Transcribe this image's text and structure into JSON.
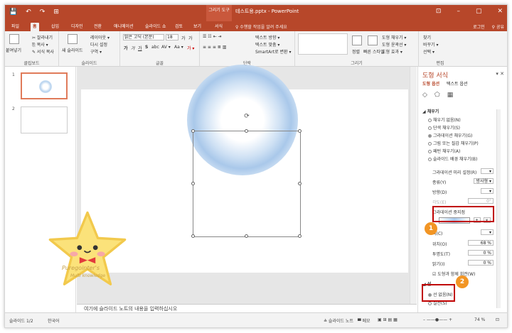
{
  "titlebar": {
    "qat": [
      "💾",
      "↶",
      "↷",
      "⊞"
    ],
    "context_tab": "그리기 도구",
    "doc_title": "테스트용.pptx - PowerPoint",
    "win": [
      "⊡",
      "–",
      "▢",
      "✕"
    ]
  },
  "tabs": [
    "파일",
    "홈",
    "삽입",
    "디자인",
    "전환",
    "애니메이션",
    "슬라이드 쇼",
    "검토",
    "보기",
    "서식"
  ],
  "tell_me": "♀ 수행할 작업을 알려 주세요",
  "login": "로그인",
  "share": "⚲ 공유",
  "ribbon": {
    "clipboard": {
      "paste": "붙여넣기",
      "cut": "✂ 잘라내기",
      "copy": "⎘ 복사 ▾",
      "format_painter": "✎ 서식 복사",
      "label": "클립보드"
    },
    "slides": {
      "new": "새 슬라이드",
      "layout": "레이아웃 ▾",
      "reset": "다시 설정",
      "section": "구역 ▾",
      "label": "슬라이드"
    },
    "font": {
      "name": "맑은 고딕 (본문)",
      "size": "18",
      "grow": "가",
      "shrink": "가",
      "clear": "가",
      "bold": "가",
      "italic": "가",
      "underline": "가",
      "strike": "S",
      "abc": "abc",
      "spacing": "AV ▾",
      "case": "Aa ▾",
      "color": "가 ▾",
      "label": "글꼴"
    },
    "paragraph": {
      "direction": "텍스트 방향 ▾",
      "align": "텍스트 맞춤 ▾",
      "smartart": "SmartArt로 변환 ▾",
      "label": "단락"
    },
    "drawing": {
      "arrange": "정렬",
      "quick": "빠른 스타일",
      "fill": "도형 채우기 ▾",
      "outline": "도형 윤곽선 ▾",
      "effect": "도형 효과 ▾",
      "label": "그리기"
    },
    "editing": {
      "find": "찾기",
      "replace": "바꾸기 ▾",
      "select": "선택 ▾",
      "label": "편집"
    }
  },
  "thumbnails": [
    {
      "num": "1"
    },
    {
      "num": "2"
    }
  ],
  "notes_placeholder": "여기에 슬라이드 노트의 내용을 입력하십시오",
  "pane": {
    "title": "도형 서식",
    "close": "▾ ✕",
    "sub_active": "도형 옵션",
    "sub_other": "텍스트 옵션",
    "section": "◢ 채우기",
    "fill_options": [
      {
        "label": "채우기 없음(N)",
        "on": false
      },
      {
        "label": "단색 채우기(S)",
        "on": false
      },
      {
        "label": "그라데이션 채우기(G)",
        "on": true
      },
      {
        "label": "그림 또는 질감 채우기(P)",
        "on": false
      },
      {
        "label": "패턴 채우기(A)",
        "on": false
      },
      {
        "label": "슬라이드 배경 채우기(B)",
        "on": false
      }
    ],
    "preset_label": "그라데이션 미리 설정(R)",
    "type_label": "종류(Y)",
    "type_value": "방사형 ▾",
    "direction_label": "방향(D)",
    "angle_label": "각도(E)",
    "angle_value": "0°",
    "stops_label": "그라데이션 중지점",
    "color_label": "색(C)",
    "position_label": "위치(O)",
    "position_value": "68 %",
    "transparency_label": "투명도(T)",
    "transparency_value": "0 %",
    "brightness_label": "밝기(I)",
    "brightness_value": "0 %",
    "rotate_label": "☑ 도형과 함께 회전(W)",
    "line_section": "◢ 선",
    "no_line": "선 없음(N)",
    "line_next": "실선(S)"
  },
  "status": {
    "slide": "슬라이드 1/2",
    "lang": "한국어",
    "notes": "≙ 슬라이드 노트",
    "memo": "▀ 메모",
    "zoom": "74 %"
  },
  "star": {
    "name": "Puregointer's",
    "sub": "Multi knowledge"
  },
  "markers": [
    "1",
    "2"
  ]
}
